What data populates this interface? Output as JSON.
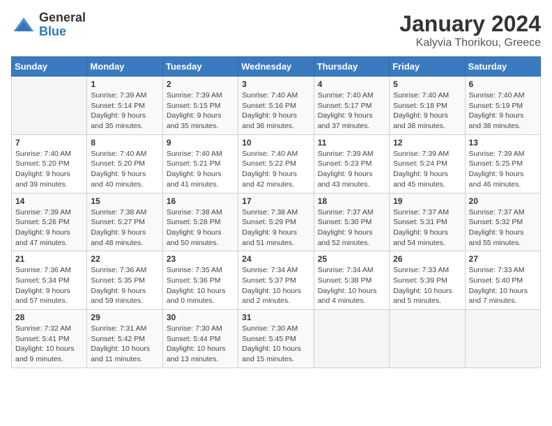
{
  "header": {
    "title": "January 2024",
    "subtitle": "Kalyvia Thorikou, Greece",
    "logo_general": "General",
    "logo_blue": "Blue"
  },
  "days_of_week": [
    "Sunday",
    "Monday",
    "Tuesday",
    "Wednesday",
    "Thursday",
    "Friday",
    "Saturday"
  ],
  "weeks": [
    [
      {
        "date": "",
        "info": ""
      },
      {
        "date": "1",
        "info": "Sunrise: 7:39 AM\nSunset: 5:14 PM\nDaylight: 9 hours and 35 minutes."
      },
      {
        "date": "2",
        "info": "Sunrise: 7:39 AM\nSunset: 5:15 PM\nDaylight: 9 hours and 35 minutes."
      },
      {
        "date": "3",
        "info": "Sunrise: 7:40 AM\nSunset: 5:16 PM\nDaylight: 9 hours and 36 minutes."
      },
      {
        "date": "4",
        "info": "Sunrise: 7:40 AM\nSunset: 5:17 PM\nDaylight: 9 hours and 37 minutes."
      },
      {
        "date": "5",
        "info": "Sunrise: 7:40 AM\nSunset: 5:18 PM\nDaylight: 9 hours and 38 minutes."
      },
      {
        "date": "6",
        "info": "Sunrise: 7:40 AM\nSunset: 5:19 PM\nDaylight: 9 hours and 38 minutes."
      }
    ],
    [
      {
        "date": "7",
        "info": "Sunrise: 7:40 AM\nSunset: 5:20 PM\nDaylight: 9 hours and 39 minutes."
      },
      {
        "date": "8",
        "info": "Sunrise: 7:40 AM\nSunset: 5:20 PM\nDaylight: 9 hours and 40 minutes."
      },
      {
        "date": "9",
        "info": "Sunrise: 7:40 AM\nSunset: 5:21 PM\nDaylight: 9 hours and 41 minutes."
      },
      {
        "date": "10",
        "info": "Sunrise: 7:40 AM\nSunset: 5:22 PM\nDaylight: 9 hours and 42 minutes."
      },
      {
        "date": "11",
        "info": "Sunrise: 7:39 AM\nSunset: 5:23 PM\nDaylight: 9 hours and 43 minutes."
      },
      {
        "date": "12",
        "info": "Sunrise: 7:39 AM\nSunset: 5:24 PM\nDaylight: 9 hours and 45 minutes."
      },
      {
        "date": "13",
        "info": "Sunrise: 7:39 AM\nSunset: 5:25 PM\nDaylight: 9 hours and 46 minutes."
      }
    ],
    [
      {
        "date": "14",
        "info": "Sunrise: 7:39 AM\nSunset: 5:26 PM\nDaylight: 9 hours and 47 minutes."
      },
      {
        "date": "15",
        "info": "Sunrise: 7:38 AM\nSunset: 5:27 PM\nDaylight: 9 hours and 48 minutes."
      },
      {
        "date": "16",
        "info": "Sunrise: 7:38 AM\nSunset: 5:28 PM\nDaylight: 9 hours and 50 minutes."
      },
      {
        "date": "17",
        "info": "Sunrise: 7:38 AM\nSunset: 5:29 PM\nDaylight: 9 hours and 51 minutes."
      },
      {
        "date": "18",
        "info": "Sunrise: 7:37 AM\nSunset: 5:30 PM\nDaylight: 9 hours and 52 minutes."
      },
      {
        "date": "19",
        "info": "Sunrise: 7:37 AM\nSunset: 5:31 PM\nDaylight: 9 hours and 54 minutes."
      },
      {
        "date": "20",
        "info": "Sunrise: 7:37 AM\nSunset: 5:32 PM\nDaylight: 9 hours and 55 minutes."
      }
    ],
    [
      {
        "date": "21",
        "info": "Sunrise: 7:36 AM\nSunset: 5:34 PM\nDaylight: 9 hours and 57 minutes."
      },
      {
        "date": "22",
        "info": "Sunrise: 7:36 AM\nSunset: 5:35 PM\nDaylight: 9 hours and 59 minutes."
      },
      {
        "date": "23",
        "info": "Sunrise: 7:35 AM\nSunset: 5:36 PM\nDaylight: 10 hours and 0 minutes."
      },
      {
        "date": "24",
        "info": "Sunrise: 7:34 AM\nSunset: 5:37 PM\nDaylight: 10 hours and 2 minutes."
      },
      {
        "date": "25",
        "info": "Sunrise: 7:34 AM\nSunset: 5:38 PM\nDaylight: 10 hours and 4 minutes."
      },
      {
        "date": "26",
        "info": "Sunrise: 7:33 AM\nSunset: 5:39 PM\nDaylight: 10 hours and 5 minutes."
      },
      {
        "date": "27",
        "info": "Sunrise: 7:33 AM\nSunset: 5:40 PM\nDaylight: 10 hours and 7 minutes."
      }
    ],
    [
      {
        "date": "28",
        "info": "Sunrise: 7:32 AM\nSunset: 5:41 PM\nDaylight: 10 hours and 9 minutes."
      },
      {
        "date": "29",
        "info": "Sunrise: 7:31 AM\nSunset: 5:42 PM\nDaylight: 10 hours and 11 minutes."
      },
      {
        "date": "30",
        "info": "Sunrise: 7:30 AM\nSunset: 5:44 PM\nDaylight: 10 hours and 13 minutes."
      },
      {
        "date": "31",
        "info": "Sunrise: 7:30 AM\nSunset: 5:45 PM\nDaylight: 10 hours and 15 minutes."
      },
      {
        "date": "",
        "info": ""
      },
      {
        "date": "",
        "info": ""
      },
      {
        "date": "",
        "info": ""
      }
    ]
  ]
}
